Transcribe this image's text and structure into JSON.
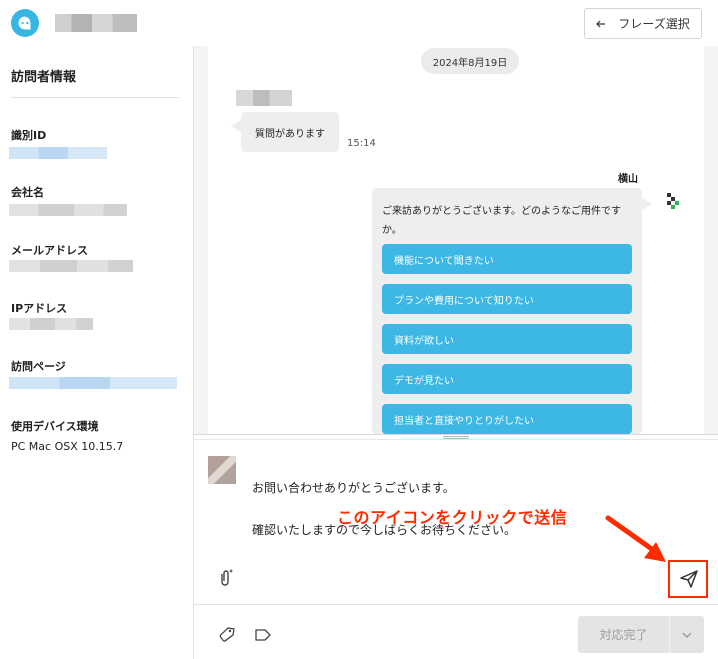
{
  "header": {
    "phrase_button_label": "フレーズ選択",
    "phrase_button_icon": "arrow-left-icon"
  },
  "sidebar": {
    "title": "訪問者情報",
    "fields": [
      {
        "label": "識別ID"
      },
      {
        "label": "会社名"
      },
      {
        "label": "メールアドレス"
      },
      {
        "label": "IPアドレス"
      },
      {
        "label": "訪問ページ"
      },
      {
        "label": "使用デバイス環境",
        "value": "PC Mac OSX 10.15.7"
      }
    ]
  },
  "chat": {
    "date": "2024年8月19日",
    "visitor_message": {
      "text": "質問があります",
      "time": "15:14"
    },
    "agent_message": {
      "name": "横山",
      "text": "ご来訪ありがとうございます。どのようなご用件ですか。",
      "choices": [
        "機能について聞きたい",
        "プランや費用について知りたい",
        "資料が欲しい",
        "デモが見たい",
        "担当者と直接やりとりがしたい"
      ]
    }
  },
  "composer": {
    "text_line1": "お問い合わせありがとうございます。",
    "text_line2": "確認いたしますので今しばらくお待ちください。",
    "annotation": "このアイコンをクリックで送信",
    "annotation_color": "#ff2a00",
    "attach_icon": "paperclip-icon",
    "send_icon": "paper-plane-icon"
  },
  "footer": {
    "tag_icon": "tag-icon",
    "label_icon": "label-icon",
    "complete_button_label": "対応完了",
    "complete_caret_icon": "chevron-down-icon"
  },
  "colors": {
    "accent": "#3db7e4",
    "brand": "#35b6e3",
    "annotation": "#ff2a00"
  }
}
